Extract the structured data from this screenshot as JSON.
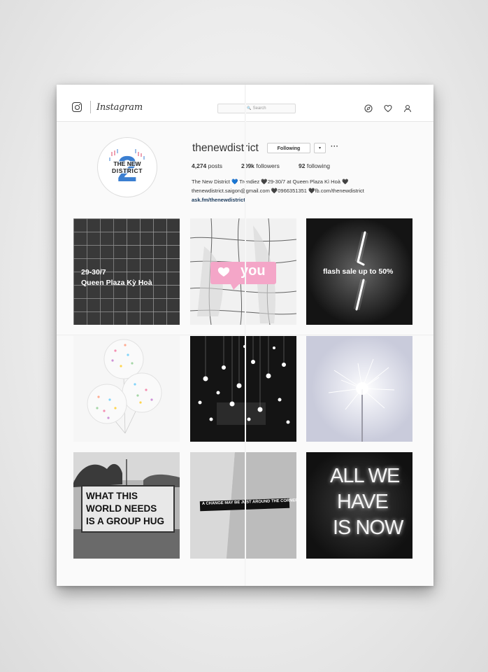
{
  "app": {
    "name": "Instagram"
  },
  "search": {
    "placeholder": "Search",
    "icon": "search-icon"
  },
  "nav_icons": [
    "explore-icon",
    "heart-icon",
    "user-icon"
  ],
  "profile": {
    "username": "thenewdistrict",
    "follow_label": "Following",
    "dropdown_label": "▾",
    "more_label": "···",
    "avatar_text": [
      "THE NEW",
      "DISTRICT",
      "2"
    ],
    "stats": [
      {
        "value": "4,274",
        "label": "posts"
      },
      {
        "value": "209k",
        "label": "followers"
      },
      {
        "value": "92",
        "label": "following"
      }
    ],
    "bio": {
      "line1": "The New District 💙 Trendiez 🖤29-30/7 at Queen Plaza Kì Hoà 🖤",
      "line2": "thenewdistrict.saigon@gmail.com 🖤0966351351 🖤fb.com/thenewdistrict",
      "link": "ask.fm/thenewdistrict"
    }
  },
  "posts": [
    {
      "caption_line1": "29-30/7",
      "caption_line2": "Queen Plaza Kỳ Hoà"
    },
    {
      "caption": "you"
    },
    {
      "caption": "flash sale up to 50%"
    },
    {},
    {},
    {},
    {
      "sign_line1": "WHAT THIS",
      "sign_line2": "WORLD NEEDS",
      "sign_line3": "IS A GROUP HUG"
    },
    {
      "caption": "A CHANGE MAY BE JUST AROUND THE CORNER"
    },
    {
      "line1": "ALL WE",
      "line2": "HAVE",
      "line3": "IS NOW"
    }
  ],
  "colors": {
    "accent_pink": "#f4a6c8",
    "link": "#1b3a5c",
    "avatar_blue": "#3b7fd1"
  }
}
